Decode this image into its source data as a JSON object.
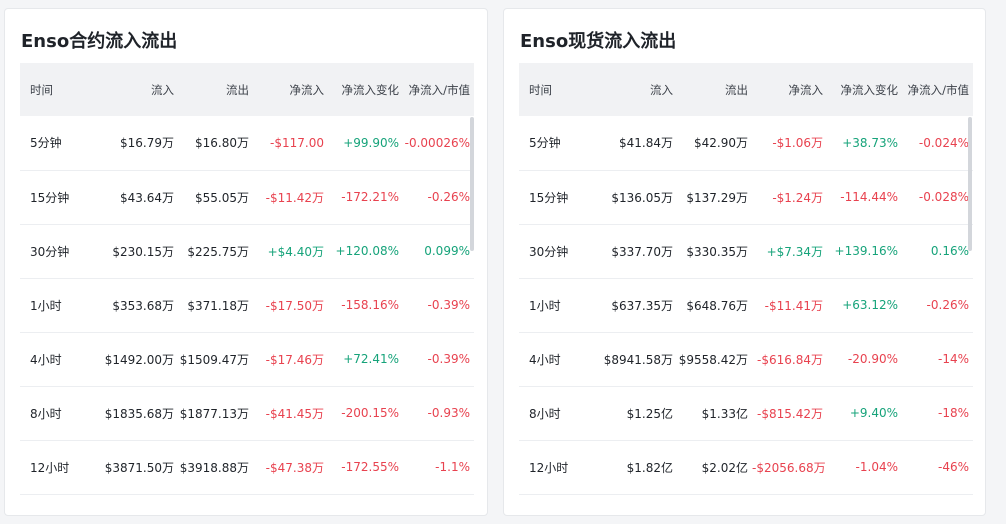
{
  "panels": [
    {
      "title": "Enso合约流入流出",
      "headers": [
        "时间",
        "流入",
        "流出",
        "净流入",
        "净流入变化",
        "净流入/市值"
      ],
      "rows": [
        {
          "time": "5分钟",
          "inflow": "$16.79万",
          "outflow": "$16.80万",
          "net": "-$117.00",
          "change": "+99.90%",
          "ratio": "-0.00026%"
        },
        {
          "time": "15分钟",
          "inflow": "$43.64万",
          "outflow": "$55.05万",
          "net": "-$11.42万",
          "change": "-172.21%",
          "ratio": "-0.26%"
        },
        {
          "time": "30分钟",
          "inflow": "$230.15万",
          "outflow": "$225.75万",
          "net": "+$4.40万",
          "change": "+120.08%",
          "ratio": "0.099%"
        },
        {
          "time": "1小时",
          "inflow": "$353.68万",
          "outflow": "$371.18万",
          "net": "-$17.50万",
          "change": "-158.16%",
          "ratio": "-0.39%"
        },
        {
          "time": "4小时",
          "inflow": "$1492.00万",
          "outflow": "$1509.47万",
          "net": "-$17.46万",
          "change": "+72.41%",
          "ratio": "-0.39%"
        },
        {
          "time": "8小时",
          "inflow": "$1835.68万",
          "outflow": "$1877.13万",
          "net": "-$41.45万",
          "change": "-200.15%",
          "ratio": "-0.93%"
        },
        {
          "time": "12小时",
          "inflow": "$3871.50万",
          "outflow": "$3918.88万",
          "net": "-$47.38万",
          "change": "-172.55%",
          "ratio": "-1.1%"
        }
      ]
    },
    {
      "title": "Enso现货流入流出",
      "headers": [
        "时间",
        "流入",
        "流出",
        "净流入",
        "净流入变化",
        "净流入/市值"
      ],
      "rows": [
        {
          "time": "5分钟",
          "inflow": "$41.84万",
          "outflow": "$42.90万",
          "net": "-$1.06万",
          "change": "+38.73%",
          "ratio": "-0.024%"
        },
        {
          "time": "15分钟",
          "inflow": "$136.05万",
          "outflow": "$137.29万",
          "net": "-$1.24万",
          "change": "-114.44%",
          "ratio": "-0.028%"
        },
        {
          "time": "30分钟",
          "inflow": "$337.70万",
          "outflow": "$330.35万",
          "net": "+$7.34万",
          "change": "+139.16%",
          "ratio": "0.16%"
        },
        {
          "time": "1小时",
          "inflow": "$637.35万",
          "outflow": "$648.76万",
          "net": "-$11.41万",
          "change": "+63.12%",
          "ratio": "-0.26%"
        },
        {
          "time": "4小时",
          "inflow": "$8941.58万",
          "outflow": "$9558.42万",
          "net": "-$616.84万",
          "change": "-20.90%",
          "ratio": "-14%"
        },
        {
          "time": "8小时",
          "inflow": "$1.25亿",
          "outflow": "$1.33亿",
          "net": "-$815.42万",
          "change": "+9.40%",
          "ratio": "-18%"
        },
        {
          "time": "12小时",
          "inflow": "$1.82亿",
          "outflow": "$2.02亿",
          "net": "-$2056.68万",
          "change": "-1.04%",
          "ratio": "-46%"
        }
      ]
    }
  ],
  "colors": {
    "negative": "#e8424f",
    "positive": "#16a37a",
    "header_bg": "#f1f2f4",
    "card_bg": "#ffffff",
    "page_bg": "#f4f5f7"
  }
}
